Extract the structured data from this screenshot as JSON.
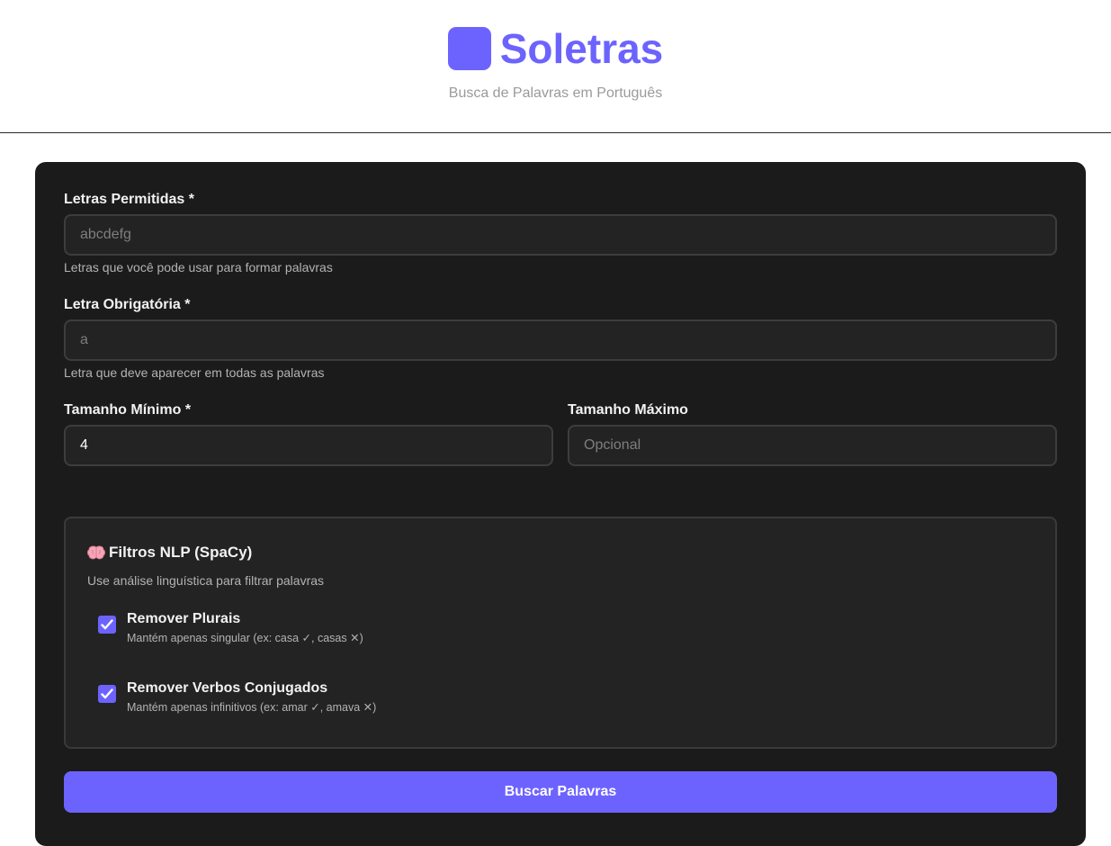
{
  "header": {
    "title": "Soletras",
    "subtitle": "Busca de Palavras em Português",
    "brand_color": "#6c63ff"
  },
  "form": {
    "letters": {
      "label": "Letras Permitidas *",
      "placeholder": "abcdefg",
      "value": "",
      "hint": "Letras que você pode usar para formar palavras"
    },
    "required_letter": {
      "label": "Letra Obrigatória *",
      "placeholder": "a",
      "value": "",
      "hint": "Letra que deve aparecer em todas as palavras"
    },
    "min_length": {
      "label": "Tamanho Mínimo *",
      "value": "4"
    },
    "max_length": {
      "label": "Tamanho Máximo",
      "placeholder": "Opcional",
      "value": ""
    }
  },
  "nlp": {
    "icon": "brain-icon",
    "title": "Filtros NLP (SpaCy)",
    "description": "Use análise linguística para filtrar palavras",
    "options": [
      {
        "title": "Remover Plurais",
        "description": "Mantém apenas singular (ex: casa ✓, casas ✕)",
        "checked": true
      },
      {
        "title": "Remover Verbos Conjugados",
        "description": "Mantém apenas infinitivos (ex: amar ✓, amava ✕)",
        "checked": true
      }
    ]
  },
  "actions": {
    "search_label": "Buscar Palavras"
  }
}
